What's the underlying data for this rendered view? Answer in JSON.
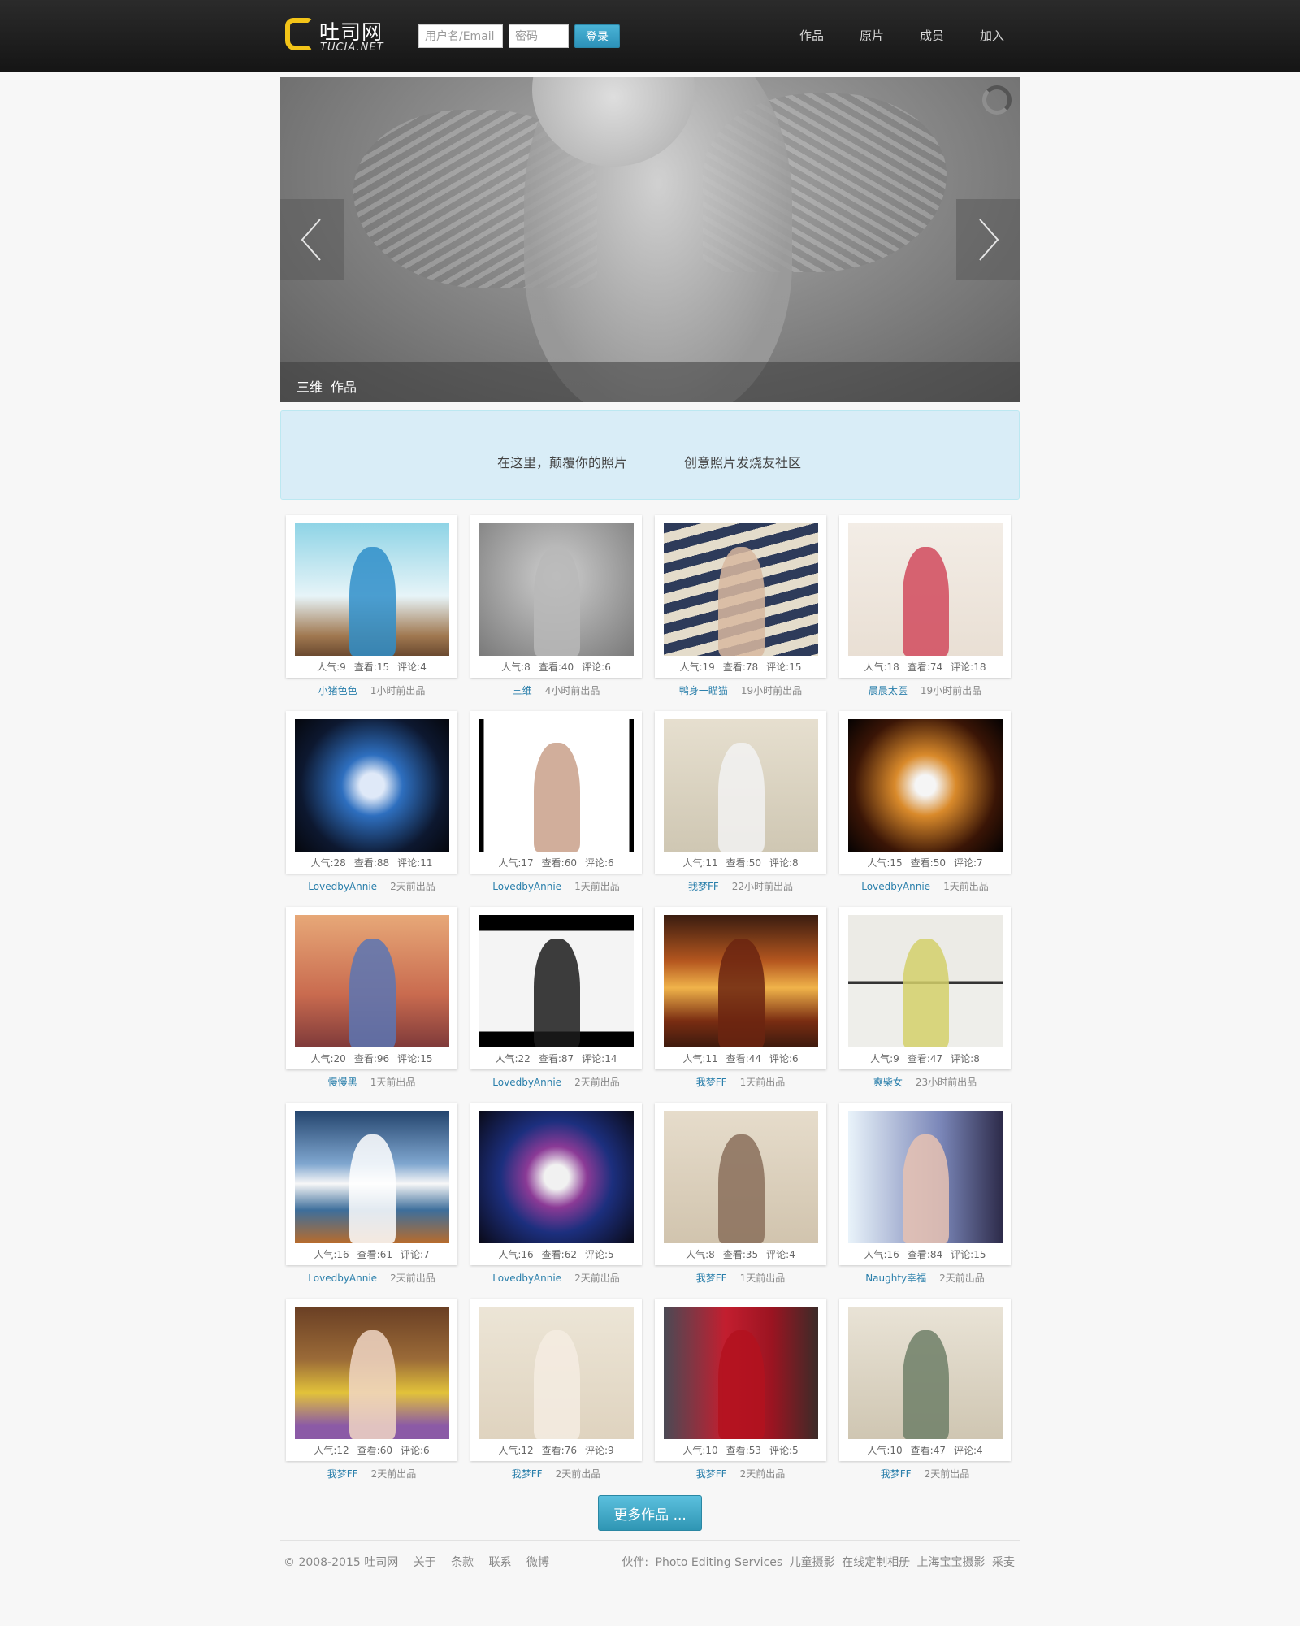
{
  "header": {
    "logo_title": "吐司网",
    "logo_sub": "TUCIA.NET",
    "username_placeholder": "用户名/Email",
    "password_placeholder": "密码",
    "login_label": "登录",
    "nav": [
      "作品",
      "原片",
      "成员",
      "加入"
    ]
  },
  "hero": {
    "caption_category": "三维",
    "caption_type": "作品"
  },
  "slogan": {
    "left": "在这里，颠覆你的照片",
    "right": "创意照片发烧友社区"
  },
  "gallery": {
    "cards": [
      {
        "popularity": "人气:9",
        "views": "查看:15",
        "comments": "评论:4",
        "author": "小猪色色",
        "time": "1小时前出品",
        "bg": "linear-gradient(#8fd4e6 0%, #e7f4f8 55%, #a07850 85%, #6b4a30 100%)",
        "fig": "#2f8ec9"
      },
      {
        "popularity": "人气:8",
        "views": "查看:40",
        "comments": "评论:6",
        "author": "三维",
        "time": "4小时前出品",
        "bg": "radial-gradient(circle at 50% 40%, #cfcfcf, #7a7a7a)",
        "fig": "#b9b9b9"
      },
      {
        "popularity": "人气:19",
        "views": "查看:78",
        "comments": "评论:15",
        "author": "鸭身一瞄猫",
        "time": "19小时前出品",
        "bg": "repeating-linear-gradient(165deg, #2e3b5a 0 12px, #e4dccb 12px 24px)",
        "fig": "#d8b9a0"
      },
      {
        "popularity": "人气:18",
        "views": "查看:74",
        "comments": "评论:18",
        "author": "晨晨太医",
        "time": "19小时前出品",
        "bg": "linear-gradient(#f3ede6, #e9dfd4)",
        "fig": "#d14a5d"
      },
      {
        "popularity": "人气:28",
        "views": "查看:88",
        "comments": "评论:11",
        "author": "LovedbyAnnie",
        "time": "2天前出品",
        "bg": "radial-gradient(circle at 50% 50%, #dfe9f8 0 12%, #2e6fbf 30%, #0d1830 70%, #05070d)",
        "fig": ""
      },
      {
        "popularity": "人气:17",
        "views": "查看:60",
        "comments": "评论:6",
        "author": "LovedbyAnnie",
        "time": "1天前出品",
        "bg": "linear-gradient(90deg, #000 0 3%, #fff 3% 97%, #000 97%)",
        "fig": "#c9a08a"
      },
      {
        "popularity": "人气:11",
        "views": "查看:50",
        "comments": "评论:8",
        "author": "我梦FF",
        "time": "22小时前出品",
        "bg": "linear-gradient(#e6dfcf, #cfc7b3)",
        "fig": "#f2f2f2"
      },
      {
        "popularity": "人气:15",
        "views": "查看:50",
        "comments": "评论:7",
        "author": "LovedbyAnnie",
        "time": "1天前出品",
        "bg": "radial-gradient(circle at 50% 50%, #f5f5f5 0 10%, #d98a2b 30%, #3a1506 70%, #050202)",
        "fig": ""
      },
      {
        "popularity": "人气:20",
        "views": "查看:96",
        "comments": "评论:15",
        "author": "慢慢黑",
        "time": "1天前出品",
        "bg": "linear-gradient(#e7a878, #c96b4f 60%, #7f3a3a)",
        "fig": "#5a76b4"
      },
      {
        "popularity": "人气:22",
        "views": "查看:87",
        "comments": "评论:14",
        "author": "LovedbyAnnie",
        "time": "2天前出品",
        "bg": "linear-gradient(#000 0 12%, #f4f4f4 12% 88%, #000 88%)",
        "fig": "#1b1b1b"
      },
      {
        "popularity": "人气:11",
        "views": "查看:44",
        "comments": "评论:6",
        "author": "我梦FF",
        "time": "1天前出品",
        "bg": "linear-gradient(#3a1c10, #b5571f 35%, #f0b34a 55%, #7a2d12 80%, #3d1a0e)",
        "fig": "#6b2410"
      },
      {
        "popularity": "人气:9",
        "views": "查看:47",
        "comments": "评论:8",
        "author": "爽柴女",
        "time": "23小时前出品",
        "bg": "linear-gradient(#ecebe6 0 50%, #333 50% 52%, #eeeeea 52%)",
        "fig": "#d4d06a"
      },
      {
        "popularity": "人气:16",
        "views": "查看:61",
        "comments": "评论:7",
        "author": "LovedbyAnnie",
        "time": "2天前出品",
        "bg": "linear-gradient(#24456e, #7fa6cf 40%, #f7f7f7 55%, #3d6e9b 75%, #b86c2c)",
        "fig": "#ffffff"
      },
      {
        "popularity": "人气:16",
        "views": "查看:62",
        "comments": "评论:5",
        "author": "LovedbyAnnie",
        "time": "2天前出品",
        "bg": "radial-gradient(circle at 50% 50%, #f1f1f1 0 12%, #8b3a96 30%, #1c2f7e 55%, #0a0a18)",
        "fig": ""
      },
      {
        "popularity": "人气:8",
        "views": "查看:35",
        "comments": "评论:4",
        "author": "我梦FF",
        "time": "1天前出品",
        "bg": "linear-gradient(#e6dccb, #d1c4ae)",
        "fig": "#8a6e5b"
      },
      {
        "popularity": "人气:16",
        "views": "查看:84",
        "comments": "评论:15",
        "author": "Naughty幸福",
        "time": "2天前出品",
        "bg": "linear-gradient(90deg, #e9f3fa, #7a86b8 60%, #2d2b4a)",
        "fig": "#e7c2b2"
      },
      {
        "popularity": "人气:12",
        "views": "查看:60",
        "comments": "评论:6",
        "author": "我梦FF",
        "time": "2天前出品",
        "bg": "linear-gradient(#6a3f24, #9b6b38 40%, #e2c23a 65%, #8b5aa6 90%)",
        "fig": "#f0d6c4"
      },
      {
        "popularity": "人气:12",
        "views": "查看:76",
        "comments": "评论:9",
        "author": "我梦FF",
        "time": "2天前出品",
        "bg": "linear-gradient(#ece5d6, #dfd3bf)",
        "fig": "#f4ece2"
      },
      {
        "popularity": "人气:10",
        "views": "查看:53",
        "comments": "评论:5",
        "author": "我梦FF",
        "time": "2天前出品",
        "bg": "linear-gradient(90deg, #4a4a55, #c31e2f 40%, #9b1421 70%, #3b2b28)",
        "fig": "#b3121f"
      },
      {
        "popularity": "人气:10",
        "views": "查看:47",
        "comments": "评论:4",
        "author": "我梦FF",
        "time": "2天前出品",
        "bg": "linear-gradient(#e9e3d6, #cfc6b2)",
        "fig": "#6f7f67"
      }
    ]
  },
  "more_label": "更多作品 ...",
  "footer": {
    "copyright": "© 2008-2015 吐司网",
    "links": [
      "关于",
      "条款",
      "联系",
      "微博"
    ],
    "partner_label": "伙伴:",
    "partners": [
      "Photo Editing Services",
      "儿童摄影",
      "在线定制相册",
      "上海宝宝摄影",
      "采麦"
    ]
  },
  "colors": {
    "accent": "#2f96b4",
    "author_link": "#2a7fab",
    "logo_yellow": "#f3c418",
    "slogan_bg": "#d9edf7"
  }
}
